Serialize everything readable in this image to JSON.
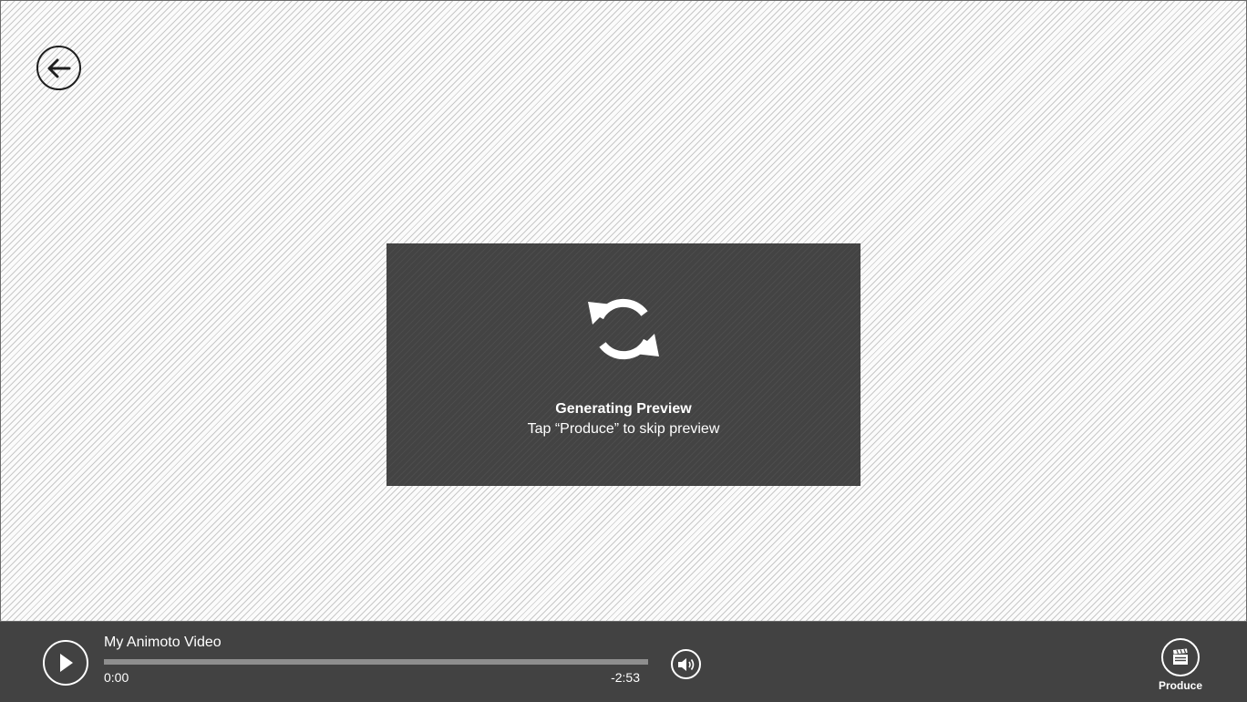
{
  "navigation": {
    "back_icon": "arrow-left-icon"
  },
  "preview": {
    "icon": "refresh-icon",
    "title": "Generating Preview",
    "subtitle": "Tap “Produce” to skip preview"
  },
  "player": {
    "play_icon": "play-icon",
    "video_title": "My Animoto Video",
    "progress": 0,
    "current_time": "0:00",
    "remaining_time": "-2:53",
    "volume_icon": "speaker-icon"
  },
  "produce": {
    "icon": "clapperboard-icon",
    "label": "Produce"
  },
  "colors": {
    "bar_bg": "#424242",
    "preview_bg": "#434343",
    "stage_bg": "#fbfbfb"
  }
}
